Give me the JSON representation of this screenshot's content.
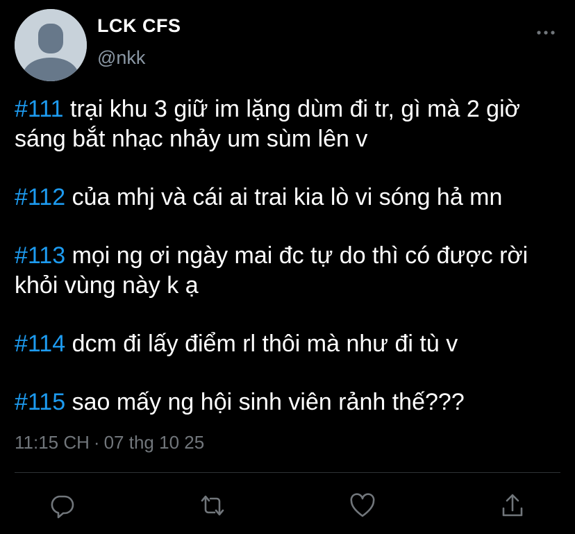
{
  "author": {
    "display_name": "LCK CFS",
    "handle": "@nkk",
    "avatar_icon": "default-avatar-icon"
  },
  "menu": {
    "icon": "more-horizontal-icon"
  },
  "confessions": [
    {
      "tag": "#111",
      "text": "trại khu 3 giữ im lặng dùm đi tr, gì mà 2 giờ sáng bắt nhạc nhảy um sùm lên v"
    },
    {
      "tag": "#112",
      "text": "của mhj và cái ai trai kia lò vi sóng hả mn"
    },
    {
      "tag": "#113",
      "text": "mọi ng ơi ngày mai đc tự do thì có được rời khỏi vùng này k ạ"
    },
    {
      "tag": "#114",
      "text": "dcm đi lấy điểm rl thôi mà như đi tù v"
    },
    {
      "tag": "#115",
      "text": "sao mấy ng hội sinh viên rảnh thế???"
    }
  ],
  "meta": {
    "time": "11:15 CH",
    "separator": "·",
    "date": "07 thg 10 25"
  },
  "actions": [
    {
      "icon": "reply-icon"
    },
    {
      "icon": "retweet-icon"
    },
    {
      "icon": "like-icon"
    },
    {
      "icon": "share-icon"
    }
  ],
  "colors": {
    "background": "#000000",
    "text": "#ffffff",
    "hashtag": "#1d9bf0",
    "secondary": "#8b98a5",
    "icon": "#71767b"
  }
}
